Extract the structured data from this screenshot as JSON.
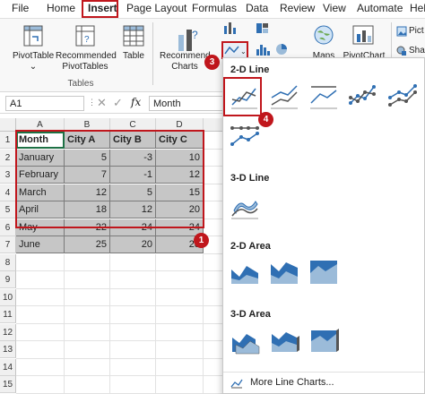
{
  "tabs": [
    "File",
    "Home",
    "Insert",
    "Page Layout",
    "Formulas",
    "Data",
    "Review",
    "View",
    "Automate",
    "Help"
  ],
  "ribbon": {
    "pivottable": "PivotTable",
    "recommended_pivot_line1": "Recommended",
    "recommended_pivot_line2": "PivotTables",
    "table": "Table",
    "tables_group": "Tables",
    "recommended_charts_line1": "Recommend",
    "recommended_charts_line2": "Charts",
    "maps": "Maps",
    "pivotchart": "PivotChart",
    "pictures_partial": "Pict",
    "shapes_partial": "Shap"
  },
  "formula_bar": {
    "name_box": "A1",
    "formula": "Month",
    "fx": "fx"
  },
  "sheet": {
    "columns": [
      "A",
      "B",
      "C",
      "D"
    ],
    "rows": [
      "1",
      "2",
      "3",
      "4",
      "5",
      "6",
      "7",
      "8",
      "9",
      "10",
      "11",
      "12",
      "13",
      "14",
      "15"
    ],
    "header": [
      "Month",
      "City A",
      "City B",
      "City C"
    ],
    "data": [
      [
        "January",
        "5",
        "-3",
        "10"
      ],
      [
        "February",
        "7",
        "-1",
        "12"
      ],
      [
        "March",
        "12",
        "5",
        "15"
      ],
      [
        "April",
        "18",
        "12",
        "20"
      ],
      [
        "May",
        "22",
        "24",
        "24"
      ],
      [
        "June",
        "25",
        "20",
        "28"
      ]
    ]
  },
  "menu": {
    "line2d": "2-D Line",
    "line3d": "3-D Line",
    "area2d": "2-D Area",
    "area3d": "3-D Area",
    "more": "More Line Charts..."
  },
  "badges": [
    "1",
    "2",
    "3",
    "4"
  ],
  "colors": {
    "accent": "#c0161c",
    "selection": "#c6c6c6",
    "chart_blue": "#2f6fb3"
  }
}
